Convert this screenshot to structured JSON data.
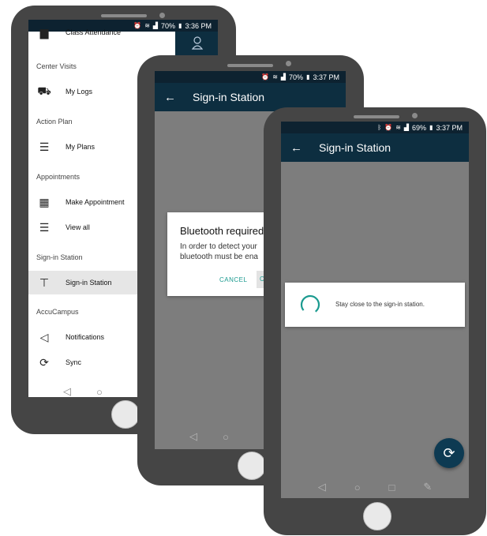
{
  "phone1": {
    "status": {
      "time": "3:36 PM",
      "battery": "70%"
    },
    "partial_top_item": "Class Attendance",
    "drawer": {
      "sections": [
        {
          "title": "Center Visits",
          "items": [
            {
              "icon": "logs-icon",
              "label": "My Logs"
            }
          ]
        },
        {
          "title": "Action Plan",
          "items": [
            {
              "icon": "list-icon",
              "label": "My Plans"
            }
          ]
        },
        {
          "title": "Appointments",
          "items": [
            {
              "icon": "calendar-icon",
              "label": "Make Appointment"
            },
            {
              "icon": "list-icon",
              "label": "View all"
            }
          ]
        },
        {
          "title": "Sign-in Station",
          "items": [
            {
              "icon": "signpost-icon",
              "label": "Sign-in Station",
              "active": true
            }
          ]
        },
        {
          "title": "AccuCampus",
          "items": [
            {
              "icon": "megaphone-icon",
              "label": "Notifications"
            },
            {
              "icon": "sync-icon",
              "label": "Sync"
            }
          ]
        }
      ]
    }
  },
  "phone2": {
    "status": {
      "time": "3:37 PM",
      "battery": "70%"
    },
    "appbar_title": "Sign-in Station",
    "dialog": {
      "title": "Bluetooth required",
      "line1": "In order to detect your",
      "line2": "bluetooth must be ena",
      "cancel": "CANCEL",
      "ok_partial": "C"
    }
  },
  "phone3": {
    "status": {
      "time": "3:37 PM",
      "battery": "69%"
    },
    "appbar_title": "Sign-in Station",
    "progress_message": "Stay close to the sign-in station.",
    "accent": "#1a9a8f",
    "fab_color": "#0d3a52"
  },
  "colors": {
    "appbar": "#0d2e40",
    "statusbar": "#0d2230",
    "overlay": "#7d7d7d"
  }
}
